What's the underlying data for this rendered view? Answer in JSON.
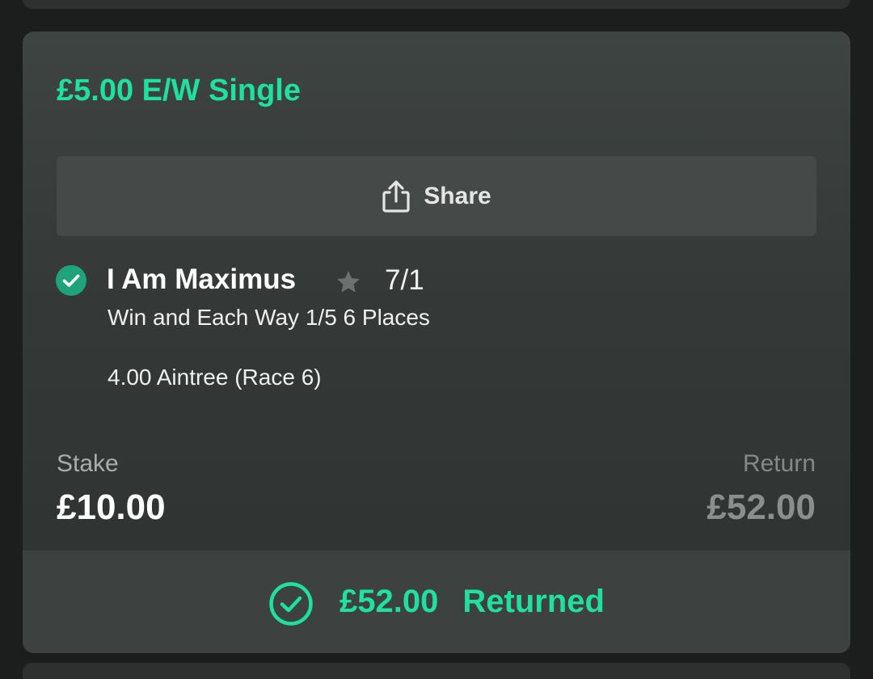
{
  "bet": {
    "title": "£5.00 E/W Single",
    "share_label": "Share",
    "selection": {
      "name": "I Am Maximus",
      "odds": "7/1",
      "market": "Win and Each Way 1/5 6 Places",
      "event": "4.00 Aintree (Race 6)",
      "status": "won"
    },
    "stake_label": "Stake",
    "stake_value": "£10.00",
    "return_label": "Return",
    "return_value": "£52.00",
    "returned_amount": "£52.00",
    "returned_label": "Returned"
  },
  "icons": {
    "share": "share-icon",
    "selection_status": "check-circle-icon",
    "favourite": "star-icon",
    "returned": "check-circle-outline-icon"
  },
  "colors": {
    "accent": "#1fe0a0",
    "win_check": "#1fa37a"
  }
}
